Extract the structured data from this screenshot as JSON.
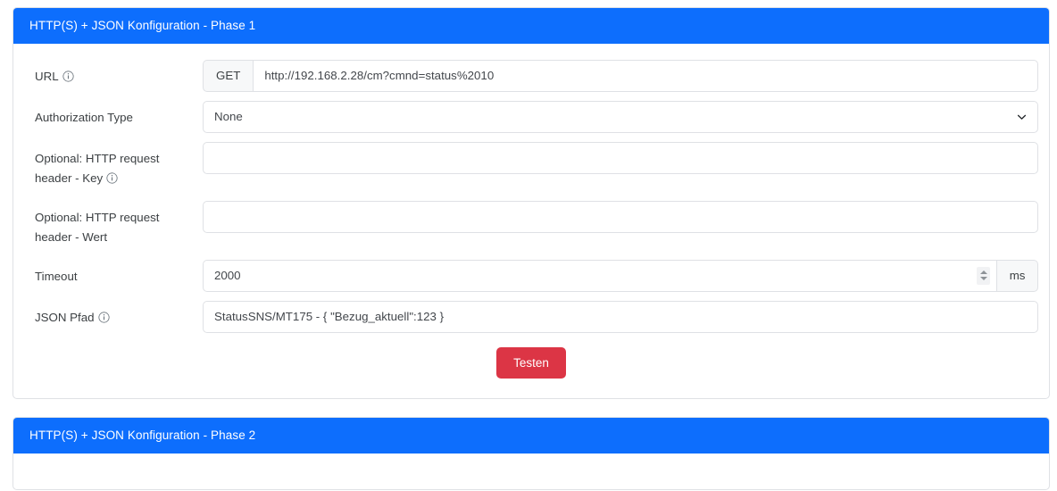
{
  "colors": {
    "header_blue": "#0d6efd",
    "button_red": "#dc3545",
    "border_gray": "#dfe1e5",
    "addon_gray": "#f7f8f9",
    "text": "#3c4043"
  },
  "cards": [
    {
      "title": "HTTP(S) + JSON Konfiguration - Phase 1",
      "fields": {
        "url": {
          "label": "URL",
          "has_info": true,
          "method": "GET",
          "value": "http://192.168.2.28/cm?cmnd=status%2010",
          "placeholder": ""
        },
        "auth": {
          "label": "Authorization Type",
          "has_info": false,
          "value": "None",
          "options": [
            "None"
          ]
        },
        "header_key": {
          "label_line1": "Optional: HTTP request",
          "label_line2": "header - Key",
          "has_info": true,
          "value": "",
          "placeholder": ""
        },
        "header_value": {
          "label_line1": "Optional: HTTP request",
          "label_line2": "header - Wert",
          "has_info": false,
          "value": "",
          "placeholder": ""
        },
        "timeout": {
          "label": "Timeout",
          "has_info": false,
          "value": "2000",
          "unit": "ms"
        },
        "json_path": {
          "label": "JSON Pfad",
          "has_info": true,
          "value": "StatusSNS/MT175 - { \"Bezug_aktuell\":123 }",
          "placeholder": ""
        }
      },
      "test_button": "Testen"
    },
    {
      "title": "HTTP(S) + JSON Konfiguration - Phase 2"
    }
  ]
}
